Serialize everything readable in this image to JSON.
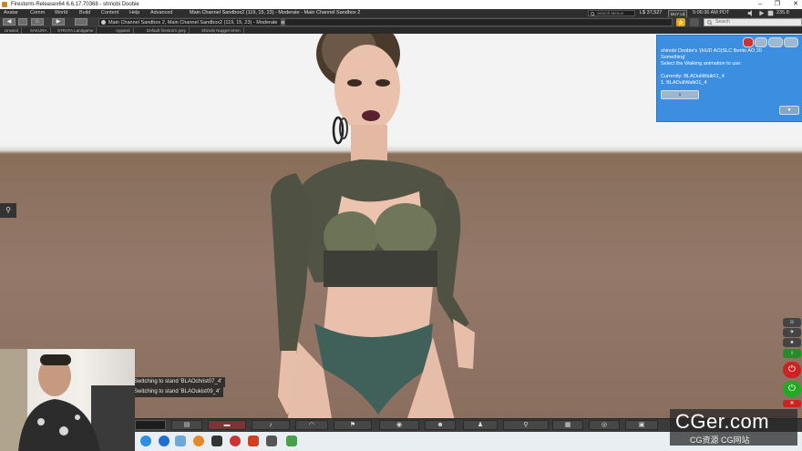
{
  "window": {
    "title": "Firestorm-Releasex64 6.6.17.70368 - shinobi Doobie",
    "controls": [
      "–",
      "❐",
      "✕"
    ]
  },
  "menubar": {
    "items": [
      "Avatar",
      "Comm",
      "World",
      "Build",
      "Content",
      "Help",
      "Advanced"
    ],
    "channel": "Main Channel Sandbox2 (119, 15, 23) - Moderate - Main Channel Sandbox 2",
    "search_placeholder": "Search Menus",
    "balance": "L$ 37,527",
    "buy_label": "BUY L$",
    "time": "5:06:36 AM PDT",
    "fps": "235.8"
  },
  "navbar": {
    "back": "◀",
    "forward": "▶",
    "home": "⌂",
    "location": "Main Channel Sandbox 2, Main Channel Sandbox2 (119, 15, 23) - Moderate",
    "maturity_badge": "M",
    "search_placeholder": "Search"
  },
  "favorites": [
    "Unwind",
    "SAKURA",
    "STRATA Landgame",
    "Apparel",
    "Default firestorm grey",
    "Shinobi Nugget Hmm"
  ],
  "hud": {
    "line1": "shinobi Doobie's '(HUD AO)SLC Bento AO 20",
    "line2": "Something'",
    "line3": "Select the Walking animation to use:",
    "line4": "Currently: BLAOuliWalk01_4",
    "line5": "1. BLAOuliWalk01_4",
    "select_label": "1",
    "dialog_button": "▼"
  },
  "chat": [
    "Switching to stand 'BLAOchrist07_4'",
    "Switching to stand 'BLAOukist09_4'"
  ],
  "toolbar": {
    "icons": [
      "inventory-icon",
      "speak-icon",
      "voice-icon",
      "gestures-icon",
      "sound-icon",
      "move-icon",
      "view-icon",
      "people-icon",
      "outfit-icon",
      "search-icon",
      "map-icon",
      "minimap-icon",
      "snapshot-icon"
    ]
  },
  "right_buttons": [
    "stand-icon",
    "fly-icon",
    "sit-icon",
    "info-icon",
    "power-icon",
    "power-icon-2",
    "close-icon"
  ],
  "watermark": {
    "big": "CGer.com",
    "small": "CG资源 CG网站"
  },
  "colors": {
    "hud_bg": "#3b8ee0",
    "ground": "#8c7260",
    "sky": "#f3f3f3"
  }
}
